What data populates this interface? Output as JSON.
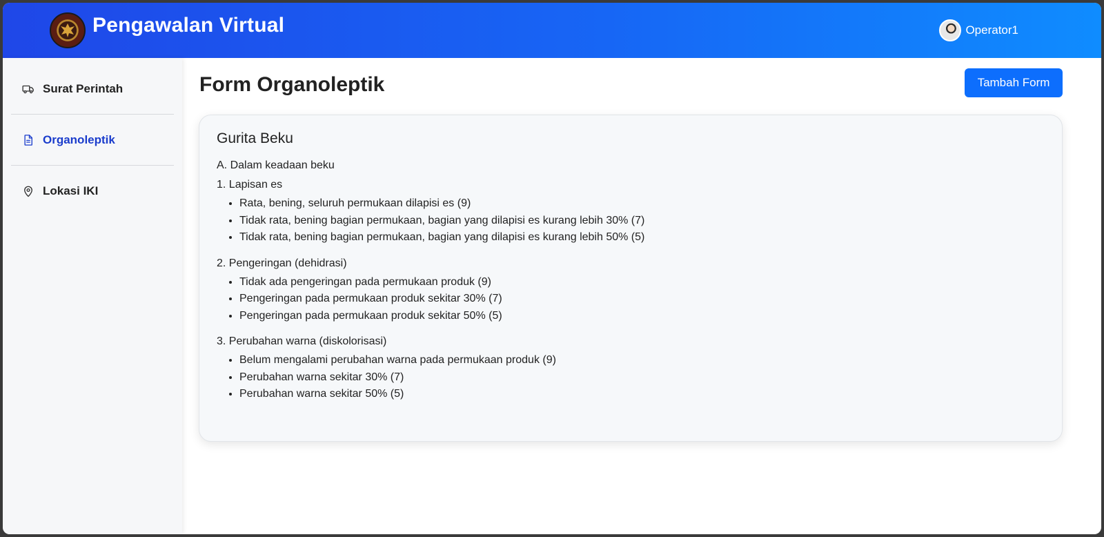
{
  "header": {
    "app_title": "Pengawalan Virtual",
    "user_name": "Operator1",
    "logo_icon": "garuda-emblem-icon",
    "colors": {
      "gradient_start": "#1f47e8",
      "gradient_end": "#0f8cff"
    }
  },
  "sidebar": {
    "items": [
      {
        "label": "Surat Perintah",
        "icon": "truck-icon",
        "active": false
      },
      {
        "label": "Organoleptik",
        "icon": "document-icon",
        "active": true
      },
      {
        "label": "Lokasi IKI",
        "icon": "map-pin-icon",
        "active": false
      }
    ]
  },
  "main": {
    "title": "Form Organoleptik",
    "add_button_label": "Tambah Form",
    "card": {
      "title": "Gurita Beku",
      "section": "A. Dalam keadaan beku",
      "groups": [
        {
          "title": "1. Lapisan es",
          "items": [
            "Rata, bening, seluruh permukaan dilapisi es (9)",
            "Tidak rata, bening bagian permukaan, bagian yang dilapisi es kurang lebih 30% (7)",
            "Tidak rata, bening bagian permukaan, bagian yang dilapisi es kurang lebih 50% (5)"
          ]
        },
        {
          "title": "2. Pengeringan (dehidrasi)",
          "items": [
            "Tidak ada pengeringan pada permukaan produk (9)",
            "Pengeringan pada permukaan produk sekitar 30% (7)",
            "Pengeringan pada permukaan produk sekitar 50% (5)"
          ]
        },
        {
          "title": "3. Perubahan warna (diskolorisasi)",
          "items": [
            "Belum mengalami perubahan warna pada permukaan produk (9)",
            "Perubahan warna sekitar 30% (7)",
            "Perubahan warna sekitar 50% (5)"
          ]
        }
      ]
    }
  },
  "colors": {
    "accent": "#0d6efd",
    "active_nav": "#1a3ccc"
  }
}
